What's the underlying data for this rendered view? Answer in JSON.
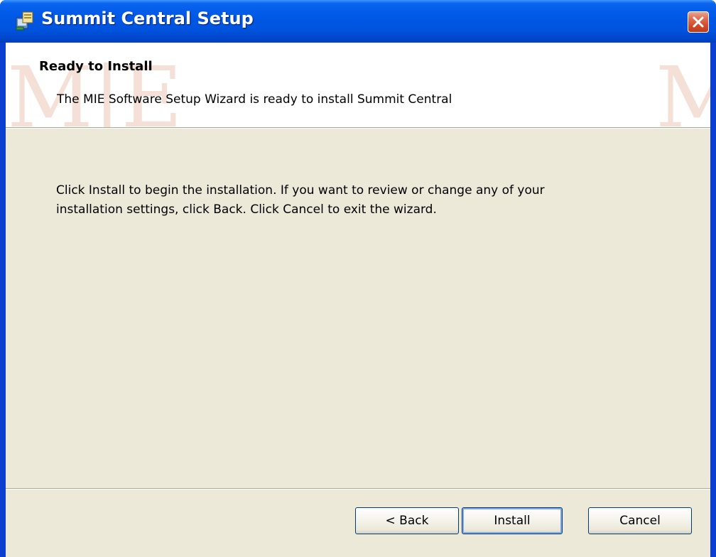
{
  "window": {
    "title": "Summit Central Setup",
    "icon": "installer-icon",
    "close_icon": "close-icon"
  },
  "banner": {
    "title": "Ready to Install",
    "subtitle": "The MIE Software Setup Wizard is ready to install Summit Central",
    "watermark_left": "M|E",
    "watermark_right": "M"
  },
  "body": {
    "line1": "Click Install to begin the installation.  If you want to review or change any of your",
    "line2": "installation settings, click Back.  Click Cancel to exit the wizard."
  },
  "buttons": {
    "back": "< Back",
    "install": "Install",
    "cancel": "Cancel"
  },
  "colors": {
    "titlebar": "#0058e6",
    "dialog_bg": "#ece9d8",
    "close_button": "#cf4a2b",
    "watermark": "#f5e0d8"
  }
}
